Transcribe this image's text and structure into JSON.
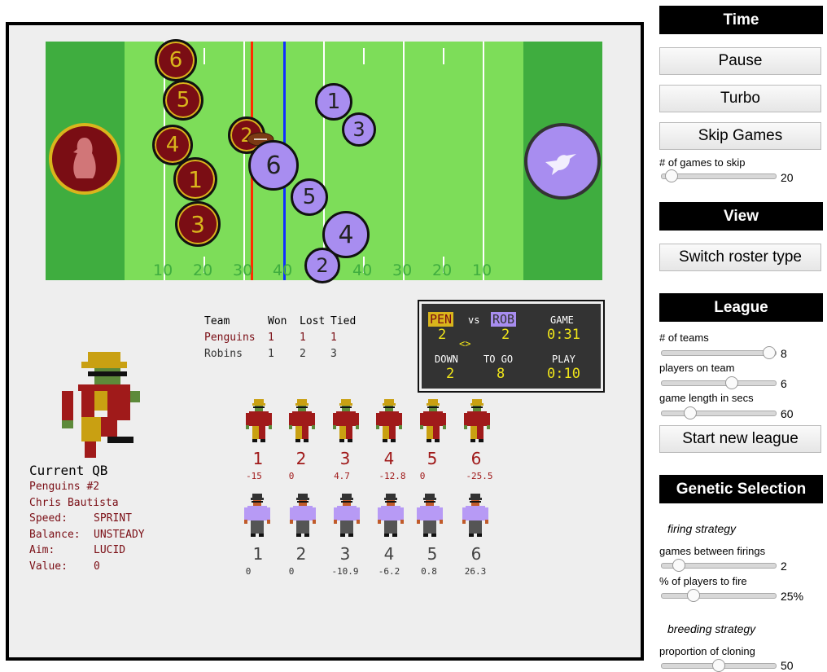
{
  "sidebar": {
    "time_header": "Time",
    "pause_label": "Pause",
    "turbo_label": "Turbo",
    "skip_label": "Skip Games",
    "skip_slider": {
      "label": "# of games to skip",
      "value": "20"
    },
    "view_header": "View",
    "switch_roster_label": "Switch roster type",
    "league_header": "League",
    "teams_slider": {
      "label": "# of teams",
      "value": "8"
    },
    "players_slider": {
      "label": "players on team",
      "value": "6"
    },
    "length_slider": {
      "label": "game length in secs",
      "value": "60"
    },
    "new_league_label": "Start new league",
    "genetic_header": "Genetic Selection",
    "firing_strategy": "firing strategy",
    "firings_slider": {
      "label": "games between firings",
      "value": "2"
    },
    "fire_pct_slider": {
      "label": "% of players to fire",
      "value": "25%"
    },
    "breeding_strategy": "breeding strategy",
    "cloning_slider": {
      "label": "proportion of cloning",
      "value": "50"
    }
  },
  "field": {
    "yard_numbers": [
      "10",
      "20",
      "30",
      "40",
      "40",
      "30",
      "20",
      "10"
    ],
    "penguins_tokens": [
      "6",
      "5",
      "4",
      "2",
      "1",
      "3"
    ],
    "robins_tokens": [
      "1",
      "3",
      "6",
      "5",
      "4",
      "2"
    ]
  },
  "standings": {
    "headers": [
      "Team",
      "Won",
      "Lost",
      "Tied"
    ],
    "rows": [
      {
        "team": "Penguins",
        "won": "1",
        "lost": "1",
        "tied": "1"
      },
      {
        "team": "Robins",
        "won": "1",
        "lost": "2",
        "tied": "3"
      }
    ]
  },
  "scoreboard": {
    "home": "PEN",
    "vs": "vs",
    "away": "ROB",
    "home_score": "2",
    "away_score": "2",
    "possession": "<>",
    "game_label": "GAME",
    "game_clock": "0:31",
    "down_label": "DOWN",
    "down": "2",
    "togo_label": "TO GO",
    "togo": "8",
    "play_label": "PLAY",
    "play_clock": "0:10"
  },
  "qb": {
    "title": "Current QB",
    "team": "Penguins #2",
    "name": "Chris Bautista",
    "speed_label": "Speed:",
    "speed": "SPRINT",
    "balance_label": "Balance:",
    "balance": "UNSTEADY",
    "aim_label": "Aim:",
    "aim": "LUCID",
    "value_label": "Value:",
    "value": "0"
  },
  "roster": {
    "penguins": [
      {
        "num": "1",
        "val": "-15"
      },
      {
        "num": "2",
        "val": "0"
      },
      {
        "num": "3",
        "val": "4.7"
      },
      {
        "num": "4",
        "val": "-12.8"
      },
      {
        "num": "5",
        "val": "0"
      },
      {
        "num": "6",
        "val": "-25.5"
      }
    ],
    "robins": [
      {
        "num": "1",
        "val": "0"
      },
      {
        "num": "2",
        "val": "0"
      },
      {
        "num": "3",
        "val": "-10.9"
      },
      {
        "num": "4",
        "val": "-6.2"
      },
      {
        "num": "5",
        "val": "0.8"
      },
      {
        "num": "6",
        "val": "26.3"
      }
    ]
  },
  "colors": {
    "penguins": "#7a0d14",
    "penguins_accent": "#d9b51c",
    "robins": "#a88df0",
    "turf": "#7ddd59",
    "endzone": "#3fad3f"
  },
  "icons": {
    "penguins_logo": "penguin-icon",
    "robins_logo": "bird-icon"
  }
}
